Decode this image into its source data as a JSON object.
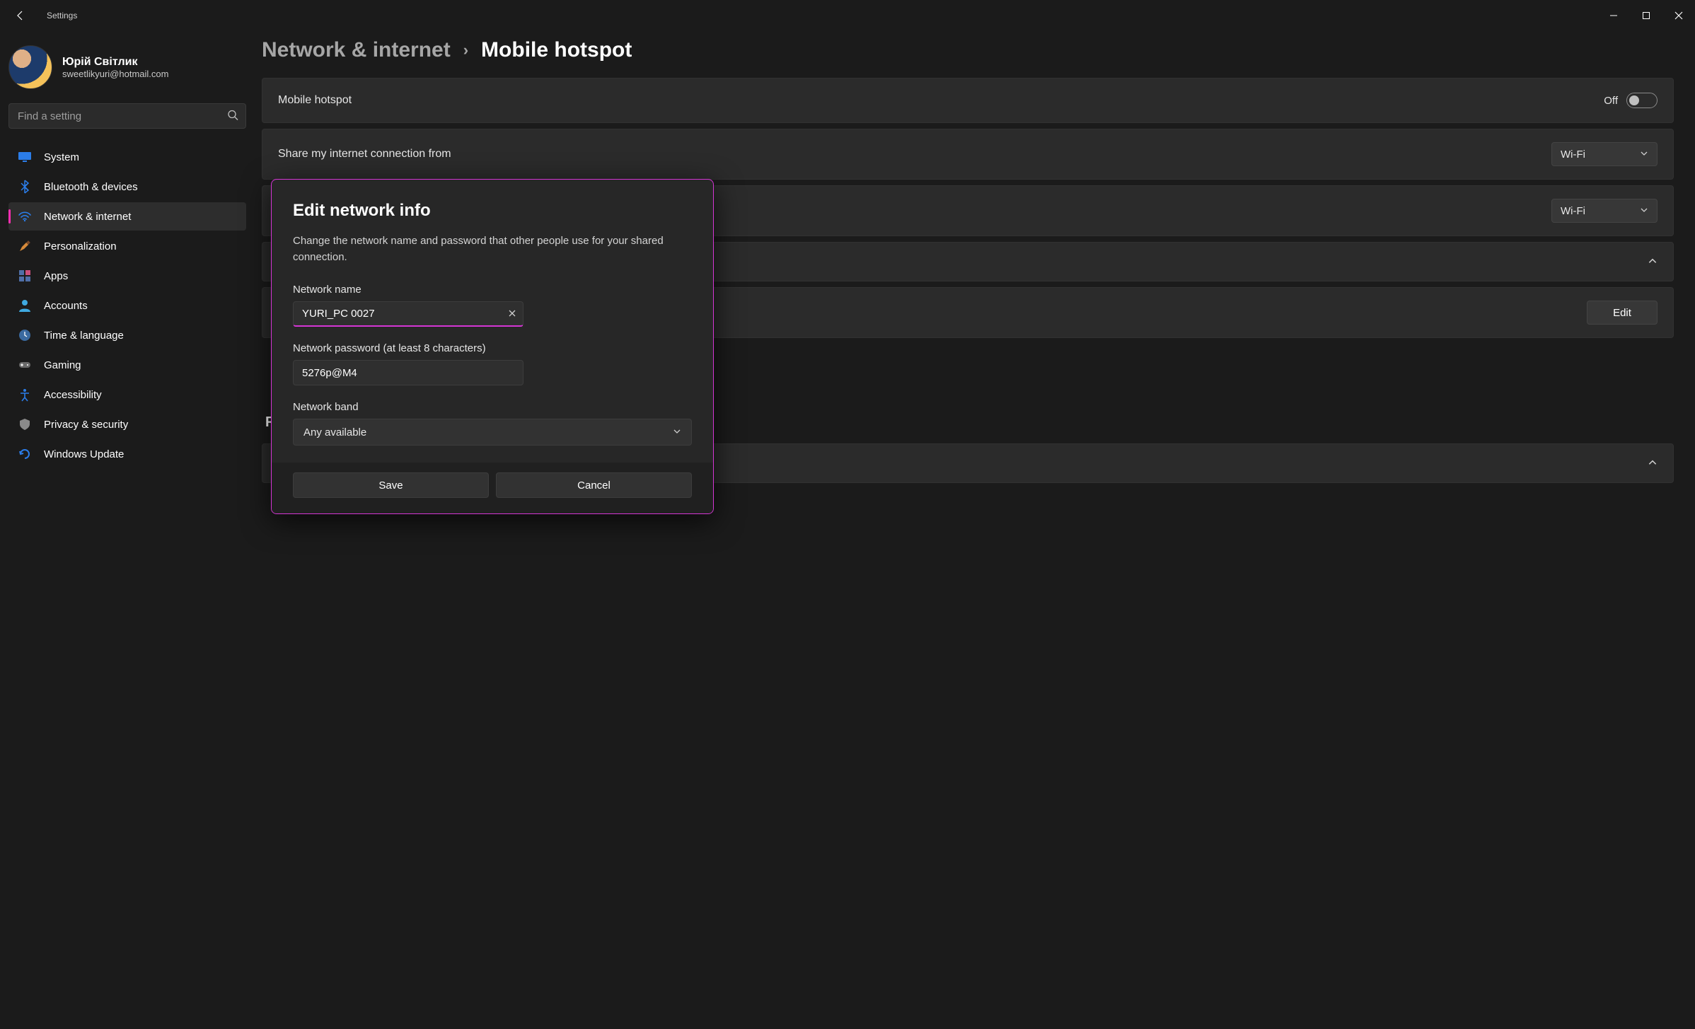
{
  "window": {
    "title": "Settings"
  },
  "user": {
    "display_name": "Юрій Світлик",
    "email": "sweetlikyuri@hotmail.com"
  },
  "search": {
    "placeholder": "Find a setting"
  },
  "nav": {
    "items": [
      {
        "label": "System",
        "icon": "monitor"
      },
      {
        "label": "Bluetooth & devices",
        "icon": "bluetooth"
      },
      {
        "label": "Network & internet",
        "icon": "wifi",
        "active": true
      },
      {
        "label": "Personalization",
        "icon": "brush"
      },
      {
        "label": "Apps",
        "icon": "apps"
      },
      {
        "label": "Accounts",
        "icon": "person"
      },
      {
        "label": "Time & language",
        "icon": "clock"
      },
      {
        "label": "Gaming",
        "icon": "gamepad"
      },
      {
        "label": "Accessibility",
        "icon": "accessibility"
      },
      {
        "label": "Privacy & security",
        "icon": "shield"
      },
      {
        "label": "Windows Update",
        "icon": "update"
      }
    ]
  },
  "breadcrumb": {
    "parent": "Network & internet",
    "current": "Mobile hotspot"
  },
  "main": {
    "hotspot_label": "Mobile hotspot",
    "hotspot_state": "Off",
    "share_from_label": "Share my internet connection from",
    "share_from_value": "Wi-Fi",
    "share_over_value": "Wi-Fi",
    "edit_label": "Edit",
    "related_heading_partial": "R"
  },
  "dialog": {
    "title": "Edit network info",
    "description": "Change the network name and password that other people use for your shared connection.",
    "name_label": "Network name",
    "name_value": "YURI_PC 0027",
    "password_label": "Network password (at least 8 characters)",
    "password_value": "5276p@M4",
    "band_label": "Network band",
    "band_value": "Any available",
    "save_label": "Save",
    "cancel_label": "Cancel"
  }
}
